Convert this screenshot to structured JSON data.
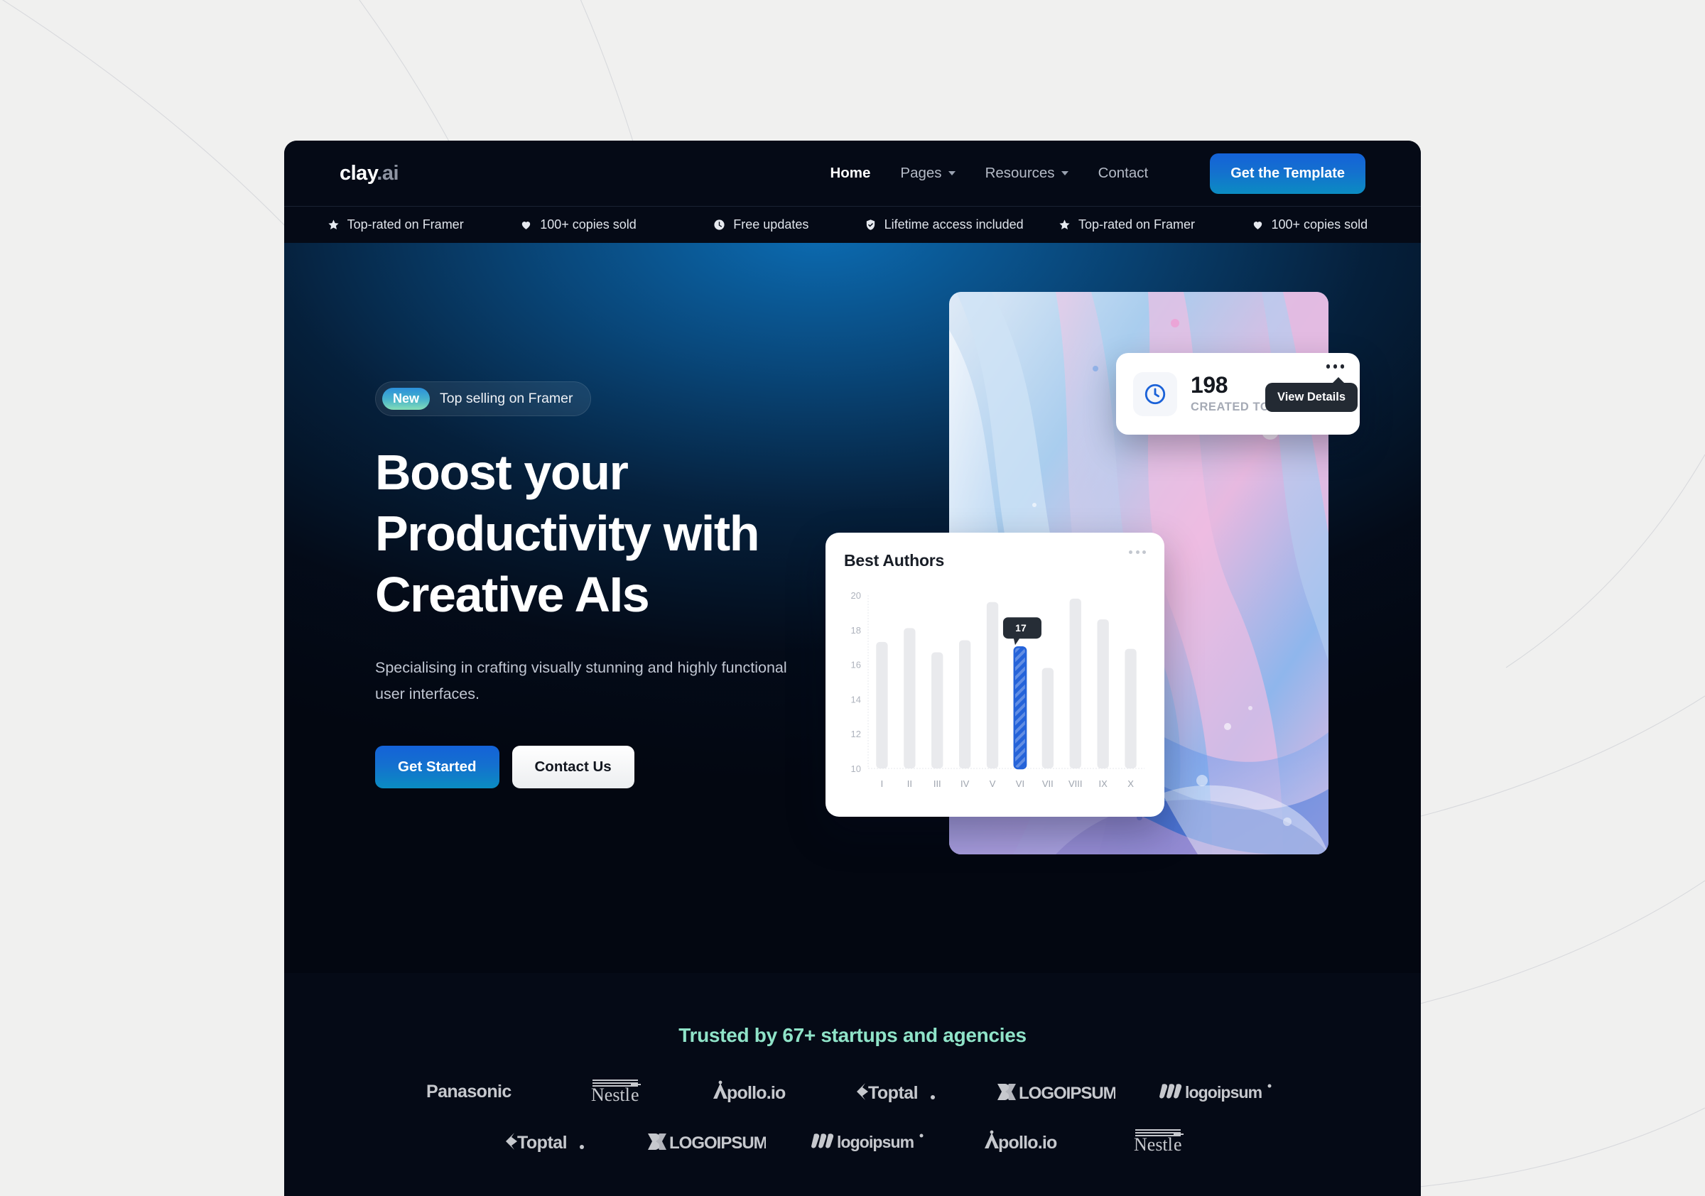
{
  "brand": {
    "name": "clay",
    "suffix": ".ai"
  },
  "nav": {
    "links": [
      {
        "label": "Home",
        "active": true,
        "caret": false
      },
      {
        "label": "Pages",
        "active": false,
        "caret": true
      },
      {
        "label": "Resources",
        "active": false,
        "caret": true
      },
      {
        "label": "Contact",
        "active": false,
        "caret": false
      }
    ],
    "cta_label": "Get the Template",
    "cta_color": "#1368d4"
  },
  "ticker": {
    "items": [
      {
        "icon": "star-icon",
        "label": "Top-rated on Framer"
      },
      {
        "icon": "heart-icon",
        "label": "100+ copies sold"
      },
      {
        "icon": "clock-icon",
        "label": "Free updates"
      },
      {
        "icon": "shield-check-icon",
        "label": "Lifetime access included"
      },
      {
        "icon": "star-icon",
        "label": "Top-rated on Framer"
      },
      {
        "icon": "heart-icon",
        "label": "100+ copies sold"
      }
    ]
  },
  "hero": {
    "badge_tag": "New",
    "badge_text": "Top selling on Framer",
    "title": "Boost your Productivity with Creative AIs",
    "subtitle": "Specialising in crafting visually stunning and highly functional user interfaces.",
    "primary_cta": "Get Started",
    "secondary_cta": "Contact Us",
    "glow_color": "#0c6eb6"
  },
  "created_card": {
    "icon": "clock-icon",
    "value": "198",
    "label": "CREATED TODAY",
    "tooltip": "View Details",
    "menu_icon": "more-horizontal-icon"
  },
  "chart_card": {
    "title": "Best Authors",
    "menu_icon": "more-horizontal-icon"
  },
  "chart_data": {
    "type": "bar",
    "title": "Best Authors",
    "xlabel": "",
    "ylabel": "",
    "categories": [
      "I",
      "II",
      "III",
      "IV",
      "V",
      "VI",
      "VII",
      "VIII",
      "IX",
      "X"
    ],
    "values": [
      17.3,
      18.1,
      16.7,
      17.4,
      19.6,
      17.0,
      15.8,
      19.8,
      18.6,
      16.9
    ],
    "ylim": [
      10,
      20
    ],
    "yticks": [
      20,
      18,
      16,
      14,
      12,
      10
    ],
    "grid": false,
    "legend": false,
    "highlight_index": 5,
    "highlight_label": "17",
    "bar_color": "#e9eaed",
    "highlight_color": "#2563d9"
  },
  "trusted": {
    "title": "Trusted by 67+ startups and agencies",
    "title_color": "#8fe3c8",
    "row1": [
      "Panasonic",
      "Nestle",
      "Apollo.io",
      "Toptal",
      "LOGOIPSUM",
      "logoipsum"
    ],
    "row2": [
      "Toptal",
      "LOGOIPSUM",
      "logoipsum",
      "Apollo.io",
      "Nestle"
    ]
  }
}
